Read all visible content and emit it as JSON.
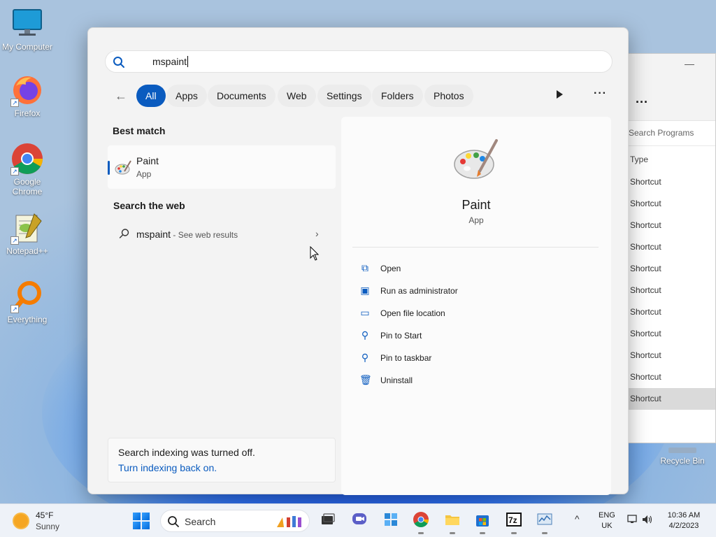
{
  "desktop": {
    "icons": [
      {
        "label": "My Computer",
        "icon": "monitor-icon"
      },
      {
        "label": "Firefox",
        "icon": "firefox-icon"
      },
      {
        "label": "Google Chrome",
        "icon": "chrome-icon"
      },
      {
        "label": "Notepad++",
        "icon": "notepadpp-icon"
      },
      {
        "label": "Everything",
        "icon": "magnifier-icon"
      }
    ],
    "recycle_bin": "Recycle Bin"
  },
  "background_window": {
    "toolbar_more": "...",
    "search_placeholder": "Search Programs",
    "column_type": "Type",
    "rows": [
      "Shortcut",
      "Shortcut",
      "Shortcut",
      "Shortcut",
      "Shortcut",
      "Shortcut",
      "Shortcut",
      "Shortcut",
      "Shortcut",
      "Shortcut",
      "Shortcut"
    ],
    "selected_row_index": 10
  },
  "search": {
    "query": "mspaint",
    "filters": [
      "All",
      "Apps",
      "Documents",
      "Web",
      "Settings",
      "Folders",
      "Photos"
    ],
    "active_filter": "All",
    "best_match_title": "Best match",
    "best_match": {
      "name": "Paint",
      "type": "App"
    },
    "web_title": "Search the web",
    "web_result": {
      "term": "mspaint",
      "hint": " - See web results"
    },
    "index_notice": {
      "message": "Search indexing was turned off.",
      "link": "Turn indexing back on."
    },
    "detail": {
      "name": "Paint",
      "type": "App",
      "actions": [
        {
          "label": "Open",
          "icon": "open-external-icon"
        },
        {
          "label": "Run as administrator",
          "icon": "shield-window-icon"
        },
        {
          "label": "Open file location",
          "icon": "folder-icon"
        },
        {
          "label": "Pin to Start",
          "icon": "pin-icon"
        },
        {
          "label": "Pin to taskbar",
          "icon": "pin-icon"
        },
        {
          "label": "Uninstall",
          "icon": "trash-icon"
        }
      ]
    }
  },
  "taskbar": {
    "weather": {
      "temp": "45°F",
      "condition": "Sunny"
    },
    "search_label": "Search",
    "language": {
      "line1": "ENG",
      "line2": "UK"
    },
    "clock": {
      "time": "10:36 AM",
      "date": "4/2/2023"
    },
    "accent": "#0a5bbf"
  }
}
